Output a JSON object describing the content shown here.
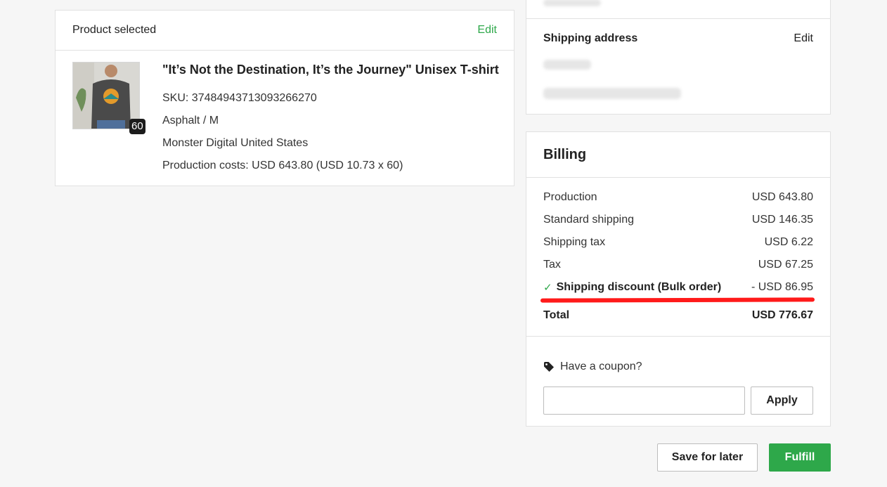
{
  "product_card": {
    "title": "Product selected",
    "edit_label": "Edit",
    "quantity_badge": "60",
    "product_name": "\"It’s Not the Destination, It’s the Journey\" Unisex T-shirt",
    "sku": "SKU: 374849437130932662​70",
    "variant": "Asphalt / M",
    "provider": "Monster Digital United States",
    "production_costs": "Production costs: USD 643.80 (USD 10.73 x 60)"
  },
  "address_card": {
    "title": "Shipping address",
    "edit_label": "Edit"
  },
  "billing": {
    "title": "Billing",
    "rows": [
      {
        "label": "Production",
        "value": "USD 643.80"
      },
      {
        "label": "Standard shipping",
        "value": "USD 146.35"
      },
      {
        "label": "Shipping tax",
        "value": "USD 6.22"
      },
      {
        "label": "Tax",
        "value": "USD 67.25"
      },
      {
        "label": "Shipping discount (Bulk order)",
        "value": "- USD 86.95"
      }
    ],
    "total_label": "Total",
    "total_value": "USD 776.67",
    "coupon_label": "Have a coupon?",
    "coupon_value": "",
    "apply_label": "Apply"
  },
  "actions": {
    "save_label": "Save for later",
    "fulfill_label": "Fulfill"
  },
  "colors": {
    "accent": "#2ea84a",
    "highlight": "#ff1a1a"
  }
}
